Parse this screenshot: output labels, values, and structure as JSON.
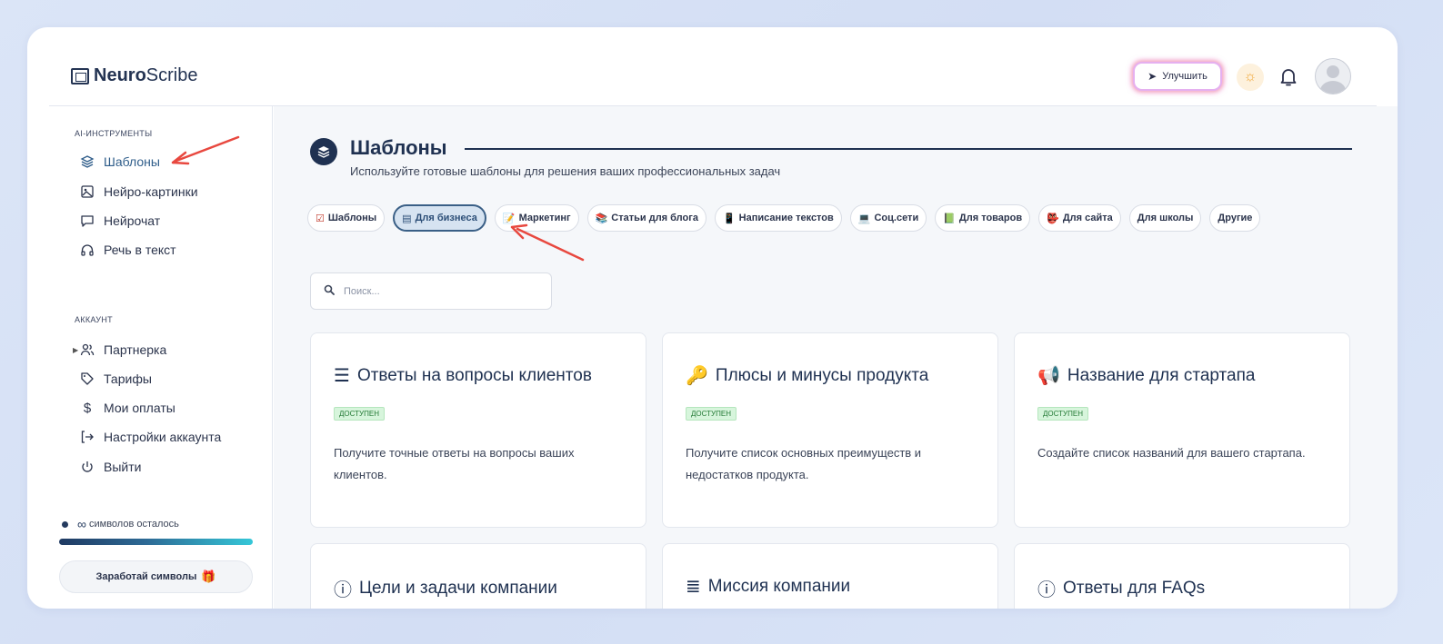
{
  "header": {
    "logo_bold": "Neuro",
    "logo_rest": "Scribe",
    "upgrade_label": "Улучшить"
  },
  "sidebar": {
    "section_tools": "AI-ИНСТРУМЕНТЫ",
    "tools": [
      {
        "label": "Шаблоны",
        "icon": "layers-icon",
        "active": true
      },
      {
        "label": "Нейро-картинки",
        "icon": "image-icon"
      },
      {
        "label": "Нейрочат",
        "icon": "chat-icon"
      },
      {
        "label": "Речь в текст",
        "icon": "headphones-icon"
      }
    ],
    "section_account": "АККАУНТ",
    "account": [
      {
        "label": "Партнерка",
        "icon": "users-icon"
      },
      {
        "label": "Тарифы",
        "icon": "tag-icon"
      },
      {
        "label": "Мои оплаты",
        "icon": "dollar-icon"
      },
      {
        "label": "Настройки аккаунта",
        "icon": "login-icon"
      },
      {
        "label": "Выйти",
        "icon": "power-icon"
      }
    ],
    "quota_symbol": "∞",
    "quota_text": "символов осталось",
    "earn_label": "Заработай символы"
  },
  "main": {
    "title": "Шаблоны",
    "subtitle": "Используйте готовые шаблоны для решения ваших профессиональных задач",
    "chips": [
      {
        "label": "Шаблоны",
        "icon": "☑"
      },
      {
        "label": "Для бизнеса",
        "icon": "▤",
        "active": true
      },
      {
        "label": "Маркетинг",
        "icon": "📝"
      },
      {
        "label": "Статьи для блога",
        "icon": "📚"
      },
      {
        "label": "Написание текстов",
        "icon": "📱"
      },
      {
        "label": "Соц.сети",
        "icon": "💻"
      },
      {
        "label": "Для товаров",
        "icon": "📗"
      },
      {
        "label": "Для сайта",
        "icon": "👺"
      },
      {
        "label": "Для школы",
        "icon": ""
      },
      {
        "label": "Другие",
        "icon": ""
      }
    ],
    "search_placeholder": "Поиск...",
    "cards": [
      {
        "title": "Ответы на вопросы клиентов",
        "icon": "list-icon",
        "badge": "ДОСТУПЕН",
        "desc": "Получите точные ответы на вопросы ваших клиентов."
      },
      {
        "title": "Плюсы и минусы продукта",
        "icon": "key-icon",
        "badge": "ДОСТУПЕН",
        "desc": "Получите список основных преимуществ и недостатков продукта."
      },
      {
        "title": "Название для стартапа",
        "icon": "megaphone-icon",
        "badge": "ДОСТУПЕН",
        "desc": "Создайте список названий для вашего стартапа."
      },
      {
        "title": "Цели и задачи компании",
        "icon": "info-icon"
      },
      {
        "title": "Миссия компании",
        "icon": "lines-icon"
      },
      {
        "title": "Ответы для FAQs",
        "icon": "info-icon"
      }
    ]
  },
  "colors": {
    "accent": "#2f5d8a",
    "annotation_arrow": "#e8483f",
    "badge_bg": "#d7f5dc"
  }
}
